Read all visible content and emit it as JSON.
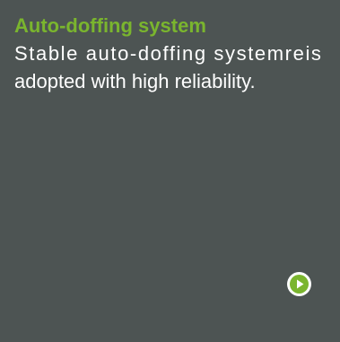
{
  "feature": {
    "title": "Auto-doffing system",
    "description_line1": "Stable auto-doffing systemreis",
    "description_line2": "adopted with high reliability."
  },
  "controls": {
    "play_icon": "play-circle-icon",
    "accent_color": "#7ab52e",
    "background_color": "#4d5453"
  }
}
